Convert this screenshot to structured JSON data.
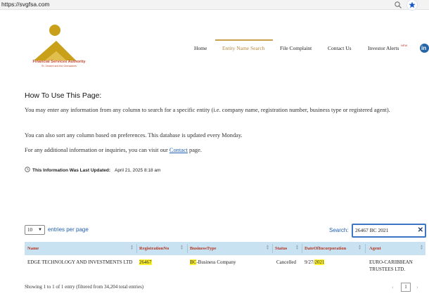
{
  "browser": {
    "url": "https://svgfsa.com"
  },
  "logo": {
    "name": "Financial Services Authority",
    "sub": "St. Vincent and the Grenadines"
  },
  "nav": {
    "items": [
      {
        "label": "Home"
      },
      {
        "label": "Entity Name Search"
      },
      {
        "label": "File Complaint"
      },
      {
        "label": "Contact Us"
      },
      {
        "label": "Investor Alerts"
      }
    ],
    "active_index": 1,
    "new_badge": "NEW",
    "linkedin": "in"
  },
  "intro": {
    "title": "How To Use This Page:",
    "p1": "You may enter any information from any column to search for a specific entity (i.e. company name, registration number, business type or registered agent).",
    "p2": "You can also sort any column based on preferences. This database is updated every Monday.",
    "p3_before": "For any additional information or inquiries, you can visit our ",
    "p3_link": "Contact",
    "p3_after": " page."
  },
  "update": {
    "label": "This Information Was Last Updated:",
    "date": "April 21, 2025",
    "time": "8:18 am"
  },
  "table_controls": {
    "per_page_value": "10",
    "per_page_label": "entries per page",
    "search_label": "Search:",
    "search_value": "26467 BC 2021",
    "clear": "✕"
  },
  "table": {
    "columns": [
      "Name",
      "RegistrationNo",
      "BusinessType",
      "Status",
      "DateOfIncorporation",
      "Agent"
    ],
    "rows": [
      {
        "name": "EDGE TECHNOLOGY AND INVESTMENTS LTD",
        "reg_no": "26467",
        "biz_hl": "BC",
        "biz_rest": "-Business Company",
        "status": "Cancelled",
        "date_prefix": "9/27/",
        "date_hl": "2021",
        "agent": "EURO-CARIBBEAN TRUSTEES LTD."
      }
    ]
  },
  "footer": {
    "showing": "Showing 1 to 1 of 1 entry (filtered from 34,204 total entries)",
    "page": "1",
    "prev": "‹",
    "next": "›"
  },
  "colors": {
    "accent_gold": "#c9a14e",
    "header_bg": "#c8e2f2",
    "header_text": "#b6341f",
    "link_blue": "#1f5eb0",
    "highlight": "#fff22a"
  }
}
